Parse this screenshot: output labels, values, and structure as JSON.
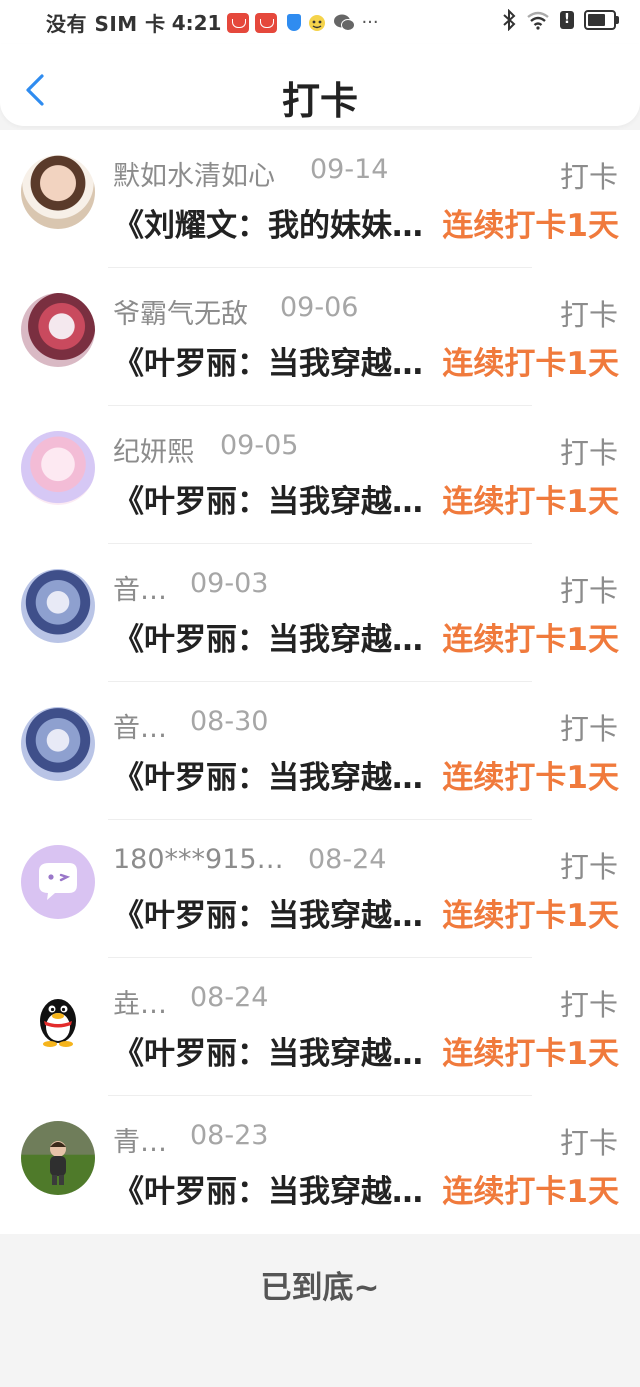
{
  "status_bar": {
    "carrier": "没有 SIM 卡",
    "time": "4:21",
    "more": "···"
  },
  "nav": {
    "title": "打卡",
    "back_icon": "chevron-left-icon"
  },
  "colors": {
    "accent_blue": "#2f8cf0",
    "streak_orange": "#f07a3c",
    "meta_gray": "#8c8c8c"
  },
  "rows": [
    {
      "name": "默如水清如心",
      "date": "09-14",
      "action": "打卡",
      "title": "《刘耀文：我的妹妹不可能这么可爱》",
      "streak": "连续打卡1天",
      "avatar": "photo-avatar"
    },
    {
      "name": "爷霸气无敌",
      "date": "09-06",
      "action": "打卡",
      "title": "《叶罗丽：当我穿越到叶罗丽》",
      "streak": "连续打卡1天",
      "avatar": "anime-avatar"
    },
    {
      "name": "纪妍熙",
      "date": "09-05",
      "action": "打卡",
      "title": "《叶罗丽：当我穿越到叶罗丽》",
      "streak": "连续打卡1天",
      "avatar": "anime-avatar"
    },
    {
      "name": "音…",
      "date": "09-03",
      "action": "打卡",
      "title": "《叶罗丽：当我穿越到叶罗丽》",
      "streak": "连续打卡1天",
      "avatar": "anime-avatar"
    },
    {
      "name": "音…",
      "date": "08-30",
      "action": "打卡",
      "title": "《叶罗丽：当我穿越到叶罗丽》",
      "streak": "连续打卡1天",
      "avatar": "anime-avatar"
    },
    {
      "name": "180***915…",
      "date": "08-24",
      "action": "打卡",
      "title": "《叶罗丽：当我穿越到叶罗丽》",
      "streak": "连续打卡1天",
      "avatar": "chat-bubble-avatar"
    },
    {
      "name": "垚…",
      "date": "08-24",
      "action": "打卡",
      "title": "《叶罗丽：当我穿越到叶罗丽》",
      "streak": "连续打卡1天",
      "avatar": "penguin-avatar"
    },
    {
      "name": "青…",
      "date": "08-23",
      "action": "打卡",
      "title": "《叶罗丽：当我穿越到叶罗丽》",
      "streak": "连续打卡1天",
      "avatar": "photo-avatar"
    }
  ],
  "footer": {
    "end_text": "已到底~"
  }
}
